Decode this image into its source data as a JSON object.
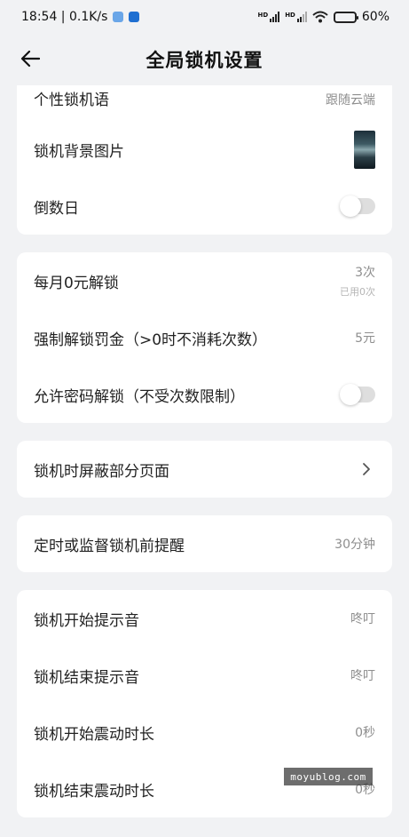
{
  "status_bar": {
    "time_speed": "18:54 | 0.1K/s",
    "battery": "60%",
    "battery_level": 0.6,
    "signal_label": "HD"
  },
  "header": {
    "title": "全局锁机设置",
    "back_icon": "arrow-left-icon"
  },
  "group1": {
    "custom_slogan": {
      "label": "个性锁机语",
      "value": "跟随云端"
    },
    "wallpaper": {
      "label": "锁机背景图片"
    },
    "countdown": {
      "label": "倒数日",
      "enabled": false
    }
  },
  "group2": {
    "monthly_free_unlock": {
      "label": "每月0元解锁",
      "value": "3次",
      "sub": "已用0次"
    },
    "forced_unlock_fine": {
      "label": "强制解锁罚金（>0时不消耗次数）",
      "value": "5元"
    },
    "password_unlock": {
      "label": "允许密码解锁（不受次数限制）",
      "enabled": false
    }
  },
  "group3": {
    "hide_pages": {
      "label": "锁机时屏蔽部分页面"
    }
  },
  "group4": {
    "reminder": {
      "label": "定时或监督锁机前提醒",
      "value": "30分钟"
    }
  },
  "group5": {
    "start_sound": {
      "label": "锁机开始提示音",
      "value": "咚叮"
    },
    "end_sound": {
      "label": "锁机结束提示音",
      "value": "咚叮"
    },
    "start_vibration": {
      "label": "锁机开始震动时长",
      "value": "0秒"
    },
    "end_vibration": {
      "label": "锁机结束震动时长",
      "value": "0秒"
    }
  },
  "watermark": "moyublog.com",
  "colors": {
    "background": "#f1f2f4",
    "card": "#ffffff",
    "value_text": "#8e8e8e",
    "toggle_off": "#dedede"
  }
}
